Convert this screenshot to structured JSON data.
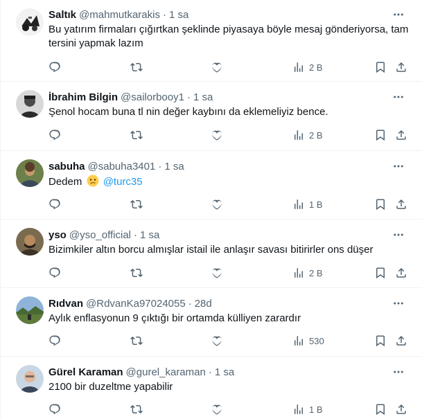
{
  "colors": {
    "text": "#0f1419",
    "secondary": "#536471",
    "accent": "#1d9bf0",
    "divider": "#eff3f4"
  },
  "icons": {
    "reply": "reply-icon",
    "retweet": "retweet-icon",
    "like": "heart-icon",
    "views": "views-icon",
    "bookmark": "bookmark-icon",
    "share": "share-icon",
    "more": "more-icon"
  },
  "tweets": [
    {
      "name": "Saltık",
      "handle": "@mahmutkarakis",
      "dot": "·",
      "time": "1 sa",
      "text_1": "Bu yatırım firmaları çığırtkan şeklinde piyasaya böyle mesaj gönderiyorsa, tam tersini yapmak lazım",
      "views": "2 B"
    },
    {
      "name": "İbrahim Bilgin",
      "handle": "@sailorbooy1",
      "dot": "·",
      "time": "1 sa",
      "text_1": "Şenol hocam buna tl nin değer kaybını da eklemeliyiz bence.",
      "views": "2 B"
    },
    {
      "name": "sabuha",
      "handle": "@sabuha3401",
      "dot": "·",
      "time": "1 sa",
      "text_1": "Dedem",
      "mention": "@turc35",
      "views": "1 B"
    },
    {
      "name": "yso",
      "handle": "@yso_official",
      "dot": "·",
      "time": "1 sa",
      "text_1": "Bizimkiler altın borcu almışlar istail ile anlaşır savası bitirirler ons düşer",
      "views": "2 B"
    },
    {
      "name": "Rıdvan",
      "handle": "@RdvanKa97024055",
      "dot": "·",
      "time": "28d",
      "text_1": "Aylık enflasyonun 9 çıktığı bir ortamda külliyen zarardır",
      "views": "530"
    },
    {
      "name": "Gürel Karaman",
      "handle": "@gurel_karaman",
      "dot": "·",
      "time": "1 sa",
      "text_1": "2100 bir duzeltme yapabilir",
      "views": "1 B"
    }
  ]
}
